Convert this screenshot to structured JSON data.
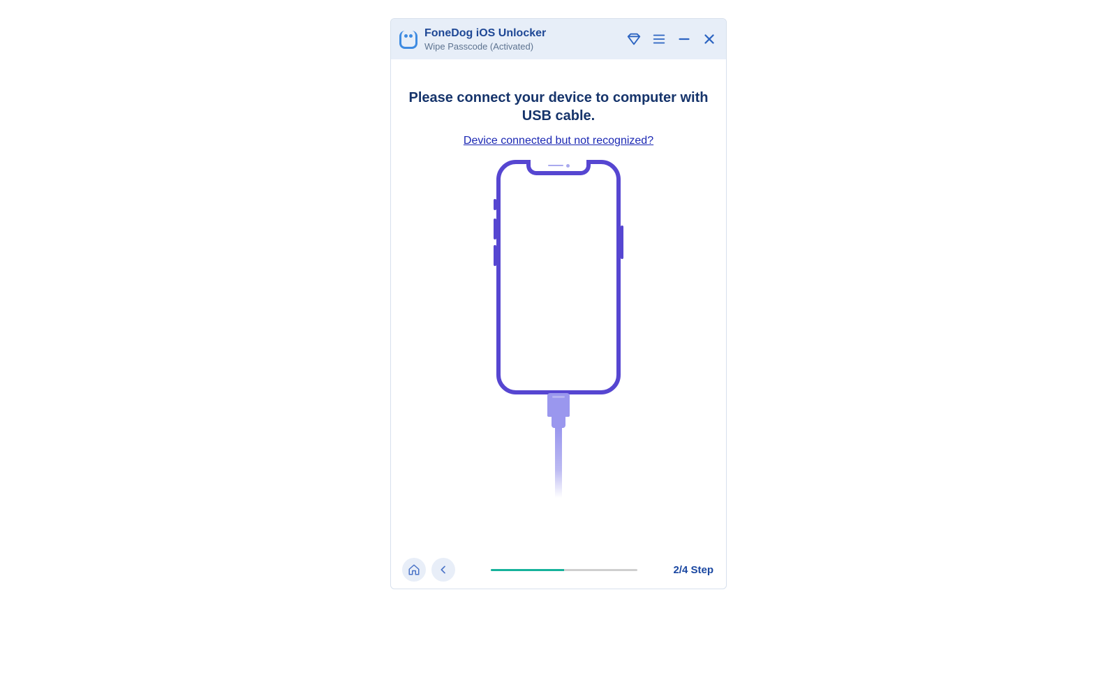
{
  "titlebar": {
    "app_name": "FoneDog iOS Unlocker",
    "subtitle": "Wipe Passcode  (Activated)"
  },
  "main": {
    "instruction": "Please connect your device to computer with USB cable.",
    "help_link": "Device connected but not recognized?"
  },
  "footer": {
    "step_label": "2/4 Step",
    "progress_percent": 50,
    "current_step": 2,
    "total_steps": 4
  },
  "colors": {
    "accent_blue": "#1e4795",
    "link_blue": "#1a27b3",
    "phone_purple": "#5646d1",
    "progress_green": "#16b29b",
    "titlebar_bg": "#e7eef8"
  }
}
